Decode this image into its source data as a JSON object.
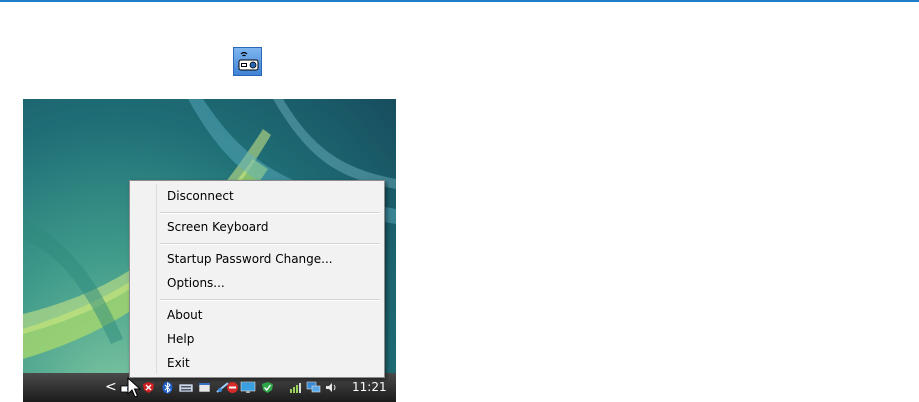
{
  "menu": {
    "items": [
      {
        "label": "Disconnect"
      },
      {
        "label": "Screen Keyboard"
      },
      {
        "label": "Startup Password Change..."
      },
      {
        "label": "Options..."
      },
      {
        "label": "About"
      },
      {
        "label": "Help"
      },
      {
        "label": "Exit"
      }
    ]
  },
  "taskbar": {
    "clock": "11:21",
    "overflow_glyph": "<",
    "icons": [
      "projector-icon",
      "shield-alert-icon",
      "bluetooth-icon",
      "keyboard-icon",
      "window-icon",
      "network-icon",
      "no-entry-icon",
      "monitor-icon",
      "security-check-icon",
      "signal-icon",
      "display-icon",
      "speaker-icon"
    ]
  },
  "colors": {
    "accent_rule": "#1e7fc7",
    "menu_bg": "#f2f2f2",
    "taskbar": "#1c1c1c"
  }
}
